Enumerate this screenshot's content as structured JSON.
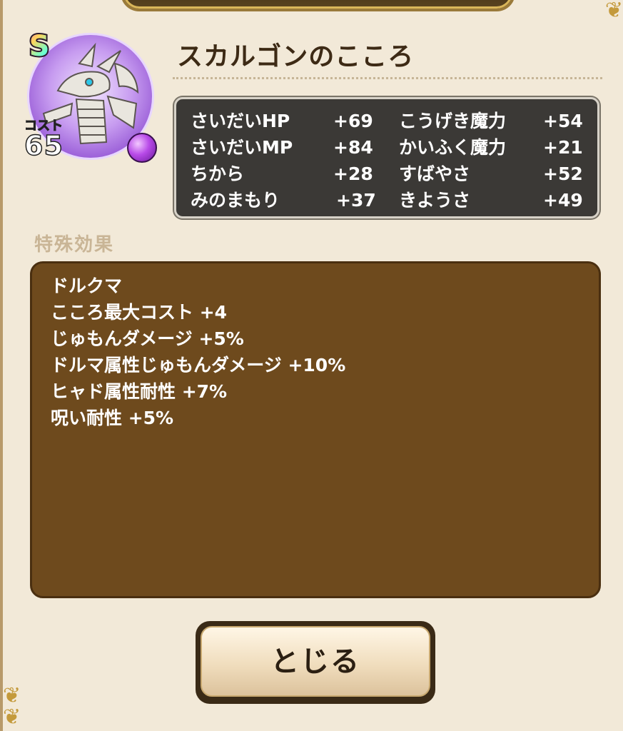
{
  "monster": {
    "name": "スカルゴンのこころ",
    "rank": "S",
    "cost_label": "コスト",
    "cost": "65",
    "colors": {
      "ring": "#9b5fd8",
      "orb": "#b84ae8"
    },
    "icon": "skeleton-dragon-icon"
  },
  "stats": [
    {
      "name": "さいだいHP",
      "value": "+69"
    },
    {
      "name": "さいだいMP",
      "value": "+84"
    },
    {
      "name": "ちから",
      "value": "+28"
    },
    {
      "name": "みのまもり",
      "value": "+37"
    },
    {
      "name": "こうげき魔力",
      "value": "+54"
    },
    {
      "name": "かいふく魔力",
      "value": "+21"
    },
    {
      "name": "すばやさ",
      "value": "+52"
    },
    {
      "name": "きようさ",
      "value": "+49"
    }
  ],
  "special": {
    "label": "特殊効果",
    "lines": [
      "ドルクマ",
      "こころ最大コスト +4",
      "じゅもんダメージ +5%",
      "ドルマ属性じゅもんダメージ +10%",
      "ヒャド属性耐性 +7%",
      "呪い耐性 +5%"
    ]
  },
  "close_button": {
    "label": "とじる"
  }
}
